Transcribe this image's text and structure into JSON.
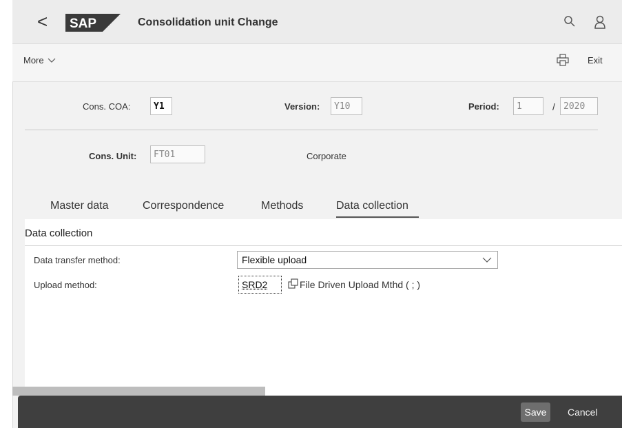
{
  "shell": {
    "back_glyph": "<",
    "logo_text": "SAP",
    "title": "Consolidation unit Change",
    "icons": [
      "search-icon",
      "user-icon"
    ]
  },
  "toolbar": {
    "more_label": "More",
    "exit_label": "Exit",
    "icons": [
      "print-icon"
    ]
  },
  "header": {
    "cons_coa_label": "Cons. COA:",
    "cons_coa_value": "Y1",
    "version_label": "Version:",
    "version_value": "Y10",
    "period_label": "Period:",
    "period_value": "1",
    "period_sep": "/",
    "year_value": "2020",
    "cons_unit_label": "Cons. Unit:",
    "cons_unit_value": "FT01",
    "cons_unit_desc": "Corporate"
  },
  "tabs": [
    {
      "label": "Master data"
    },
    {
      "label": "Correspondence"
    },
    {
      "label": "Methods"
    },
    {
      "label": "Data collection",
      "selected": true
    }
  ],
  "section": {
    "title": "Data collection",
    "data_transfer_label": "Data transfer method:",
    "data_transfer_value": "Flexible upload",
    "upload_method_label": "Upload method:",
    "upload_method_value": "SRD2",
    "upload_method_desc": "File Driven Upload Mthd ( ; )"
  },
  "footer": {
    "save_label": "Save",
    "cancel_label": "Cancel"
  },
  "colors": {
    "shell_bg": "#ececec",
    "footer_bg": "#3f3f3f",
    "save_bg": "#6e6e6e"
  }
}
